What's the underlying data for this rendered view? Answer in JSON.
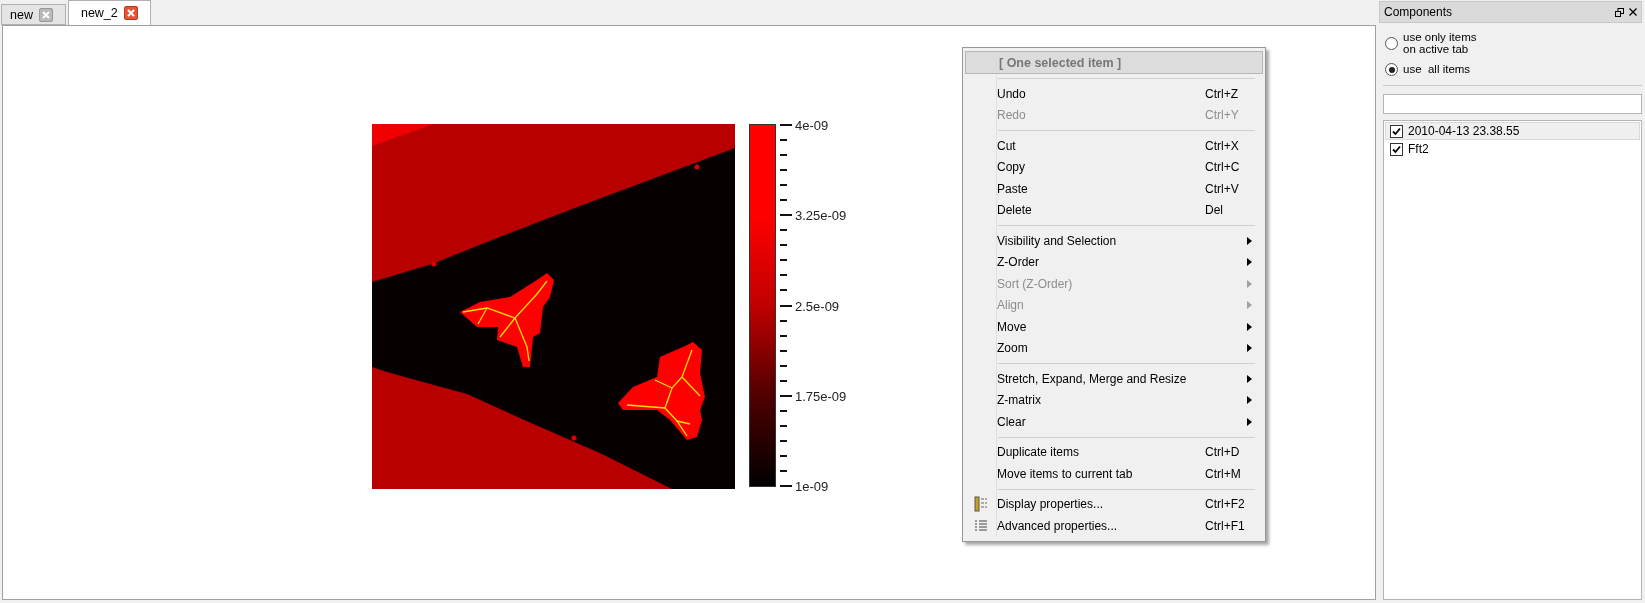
{
  "tabs": [
    {
      "label": "new",
      "selected": false
    },
    {
      "label": "new_2",
      "selected": true
    }
  ],
  "colorbar": {
    "labels": [
      "4e-09",
      "3.25e-09",
      "2.5e-09",
      "1.75e-09",
      "1e-09"
    ]
  },
  "context_menu": {
    "header": "[ One selected item ]",
    "groups": [
      [
        {
          "kind": "command",
          "label": "Undo",
          "shortcut": "Ctrl+Z",
          "disabled": false
        },
        {
          "kind": "command",
          "label": "Redo",
          "shortcut": "Ctrl+Y",
          "disabled": true
        }
      ],
      [
        {
          "kind": "command",
          "label": "Cut",
          "shortcut": "Ctrl+X",
          "disabled": false
        },
        {
          "kind": "command",
          "label": "Copy",
          "shortcut": "Ctrl+C",
          "disabled": false
        },
        {
          "kind": "command",
          "label": "Paste",
          "shortcut": "Ctrl+V",
          "disabled": false
        },
        {
          "kind": "command",
          "label": "Delete",
          "shortcut": "Del",
          "disabled": false
        }
      ],
      [
        {
          "kind": "submenu",
          "label": "Visibility and Selection",
          "disabled": false
        },
        {
          "kind": "submenu",
          "label": "Z-Order",
          "disabled": false
        },
        {
          "kind": "submenu",
          "label": "Sort (Z-Order)",
          "disabled": true
        },
        {
          "kind": "submenu",
          "label": "Align",
          "disabled": true
        },
        {
          "kind": "submenu",
          "label": "Move",
          "disabled": false
        },
        {
          "kind": "submenu",
          "label": "Zoom",
          "disabled": false
        }
      ],
      [
        {
          "kind": "submenu",
          "label": "Stretch, Expand, Merge and Resize",
          "disabled": false
        },
        {
          "kind": "submenu",
          "label": "Z-matrix",
          "disabled": false
        },
        {
          "kind": "submenu",
          "label": "Clear",
          "disabled": false
        }
      ],
      [
        {
          "kind": "command",
          "label": "Duplicate items",
          "shortcut": "Ctrl+D",
          "disabled": false
        },
        {
          "kind": "command",
          "label": "Move items to current tab",
          "shortcut": "Ctrl+M",
          "disabled": false
        }
      ],
      [
        {
          "kind": "display_command",
          "label": "Display properties...",
          "shortcut": "Ctrl+F2",
          "disabled": false
        },
        {
          "kind": "list_command",
          "label": "Advanced properties...",
          "shortcut": "Ctrl+F1",
          "disabled": false
        }
      ]
    ]
  },
  "components_panel": {
    "title": "Components",
    "scope_options": [
      {
        "label": "use only items\non active tab",
        "selected": false
      },
      {
        "label": "use  all items",
        "selected": true
      }
    ],
    "items": [
      {
        "label": "2010-04-13 23.38.55",
        "checked": true,
        "selected": true
      },
      {
        "label": "Fft2",
        "checked": true,
        "selected": false
      }
    ]
  }
}
